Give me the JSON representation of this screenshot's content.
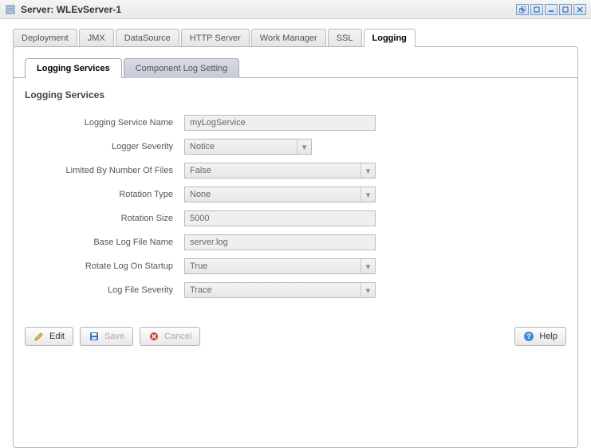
{
  "window": {
    "title": "Server: WLEvServer-1"
  },
  "main_tabs": {
    "deployment": "Deployment",
    "jmx": "JMX",
    "datasource": "DataSource",
    "http_server": "HTTP Server",
    "work_manager": "Work Manager",
    "ssl": "SSL",
    "logging": "Logging"
  },
  "sub_tabs": {
    "logging_services": "Logging Services",
    "component_log_setting": "Component Log Setting"
  },
  "section": {
    "title": "Logging Services"
  },
  "labels": {
    "logging_service_name": "Logging Service Name",
    "logger_severity": "Logger Severity",
    "limited_by_number_of_files": "Limited By Number Of Files",
    "rotation_type": "Rotation Type",
    "rotation_size": "Rotation Size",
    "base_log_file_name": "Base Log File Name",
    "rotate_log_on_startup": "Rotate Log On Startup",
    "log_file_severity": "Log File Severity"
  },
  "values": {
    "logging_service_name": "myLogService",
    "logger_severity": "Notice",
    "limited_by_number_of_files": "False",
    "rotation_type": "None",
    "rotation_size": "5000",
    "base_log_file_name": "server.log",
    "rotate_log_on_startup": "True",
    "log_file_severity": "Trace"
  },
  "buttons": {
    "edit": "Edit",
    "save": "Save",
    "cancel": "Cancel",
    "help": "Help"
  }
}
